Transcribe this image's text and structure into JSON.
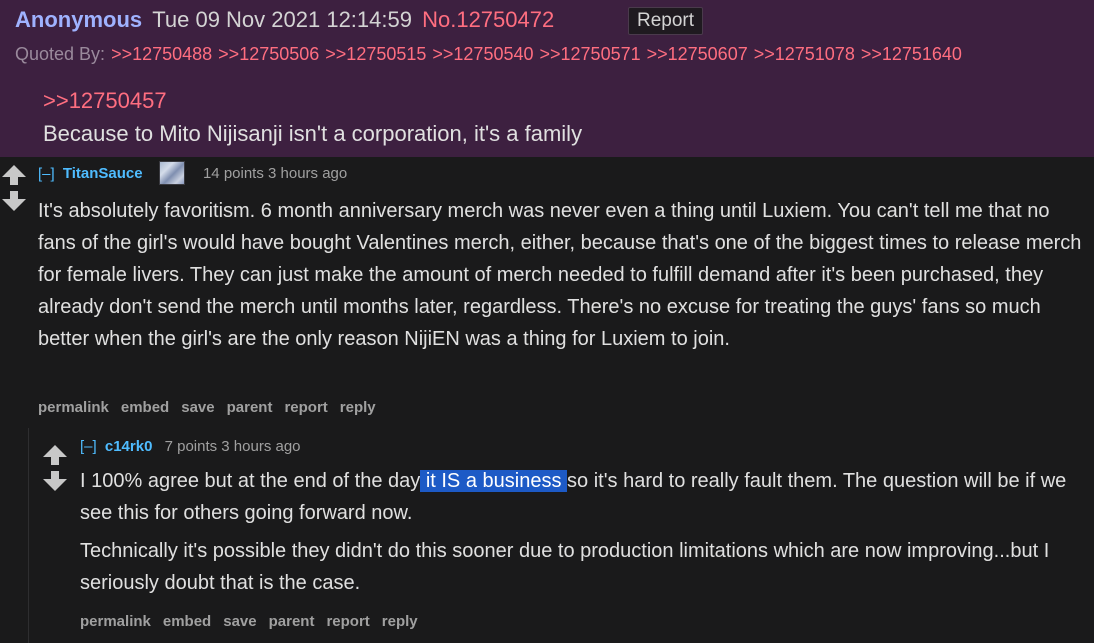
{
  "chan_post": {
    "name": "Anonymous",
    "date": "Tue 09 Nov 2021 12:14:59",
    "post_no": "No.12750472",
    "report_label": "Report",
    "quoted_by_label": "Quoted By:",
    "quoted_by": [
      ">>12750488",
      ">>12750506",
      ">>12750515",
      ">>12750540",
      ">>12750571",
      ">>12750607",
      ">>12751078",
      ">>12751640"
    ],
    "backlink": ">>12750457",
    "text": "Because to Mito Nijisanji isn't a corporation, it's a family"
  },
  "comment1": {
    "collapse": "[–]",
    "author": "TitanSauce",
    "score_time": "14 points 3 hours ago",
    "body": "It's absolutely favoritism. 6 month anniversary merch was never even a thing until Luxiem. You can't tell me that no fans of the girl's would have bought Valentines merch, either, because that's one of the biggest times to release merch for female livers. They can just make the amount of merch needed to fulfill demand after it's been purchased, they already don't send the merch until months later, regardless. There's no excuse for treating the guys' fans so much better when the girl's are the only reason NijiEN was a thing for Luxiem to join.",
    "actions": [
      "permalink",
      "embed",
      "save",
      "parent",
      "report",
      "reply"
    ]
  },
  "comment2": {
    "collapse": "[–]",
    "author": "c14rk0",
    "score_time": "7 points 3 hours ago",
    "body_p1_before": "I 100% agree but at the end of the day",
    "body_p1_highlight": " it IS a business ",
    "body_p1_after": "so it's hard to really fault them. The question will be if we see this for others going forward now.",
    "body_p2": "Technically it's possible they didn't do this sooner due to production limitations which are now improving...but I seriously doubt that is the case.",
    "actions": [
      "permalink",
      "embed",
      "save",
      "parent",
      "report",
      "reply"
    ]
  },
  "icons": {
    "vote": "up-down-arrow-icon",
    "flair": "user-flair-image"
  },
  "colors": {
    "chan_bg": "#3d2040",
    "chan_name": "#9fb2ff",
    "chan_link": "#ff6e80",
    "reddit_bg": "#1a1a1b",
    "reddit_link": "#4fbcff",
    "selection": "#1d5ac6"
  }
}
